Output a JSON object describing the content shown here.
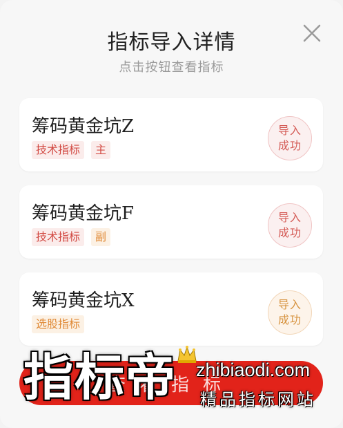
{
  "dialog": {
    "title": "指标导入详情",
    "subtitle": "点击按钮查看指标",
    "close_icon": "close-icon"
  },
  "indicators": [
    {
      "name": "筹码黄金坑Z",
      "tags": [
        {
          "label": "技术指标",
          "tone": "red"
        },
        {
          "label": "主",
          "tone": "red"
        }
      ],
      "status": {
        "line1": "导入",
        "line2": "成功",
        "tone": "red"
      }
    },
    {
      "name": "筹码黄金坑F",
      "tags": [
        {
          "label": "技术指标",
          "tone": "red"
        },
        {
          "label": "副",
          "tone": "orange"
        }
      ],
      "status": {
        "line1": "导入",
        "line2": "成功",
        "tone": "red"
      }
    },
    {
      "name": "筹码黄金坑X",
      "tags": [
        {
          "label": "选股指标",
          "tone": "orange"
        }
      ],
      "status": {
        "line1": "导入",
        "line2": "成功",
        "tone": "orange"
      }
    }
  ],
  "bottom_button": {
    "label": "查看指标"
  },
  "watermark": {
    "brand": "指标帝",
    "url": "zhibiaodi.com",
    "slogan": "精品指标网站",
    "icon": "crown-icon"
  },
  "colors": {
    "accent_red": "#e2231a",
    "tag_red": "#d24a43",
    "tag_orange": "#e08a37"
  }
}
